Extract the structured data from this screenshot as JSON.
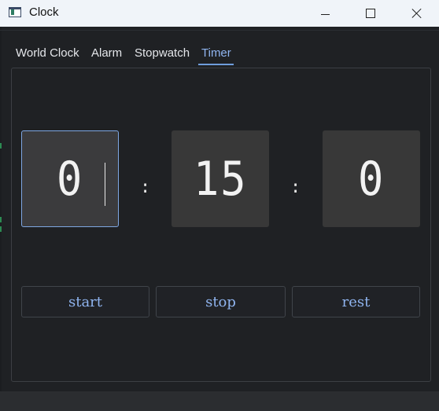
{
  "window": {
    "title": "Clock"
  },
  "icons": {
    "app": "clock-app-icon",
    "minimize": "minimize-icon",
    "maximize": "maximize-icon",
    "close": "close-icon"
  },
  "tabs": [
    {
      "label": "World Clock",
      "active": false
    },
    {
      "label": "Alarm",
      "active": false
    },
    {
      "label": "Stopwatch",
      "active": false
    },
    {
      "label": "Timer",
      "active": true
    }
  ],
  "timer": {
    "hours": "0",
    "minutes": "15",
    "seconds": "0",
    "separator": ":"
  },
  "buttons": {
    "start": "start",
    "stop": "stop",
    "reset": "rest"
  },
  "colors": {
    "accent": "#8fb4ef",
    "background": "#1f2124",
    "digit_box": "#383838",
    "titlebar": "#f0f4f9"
  }
}
